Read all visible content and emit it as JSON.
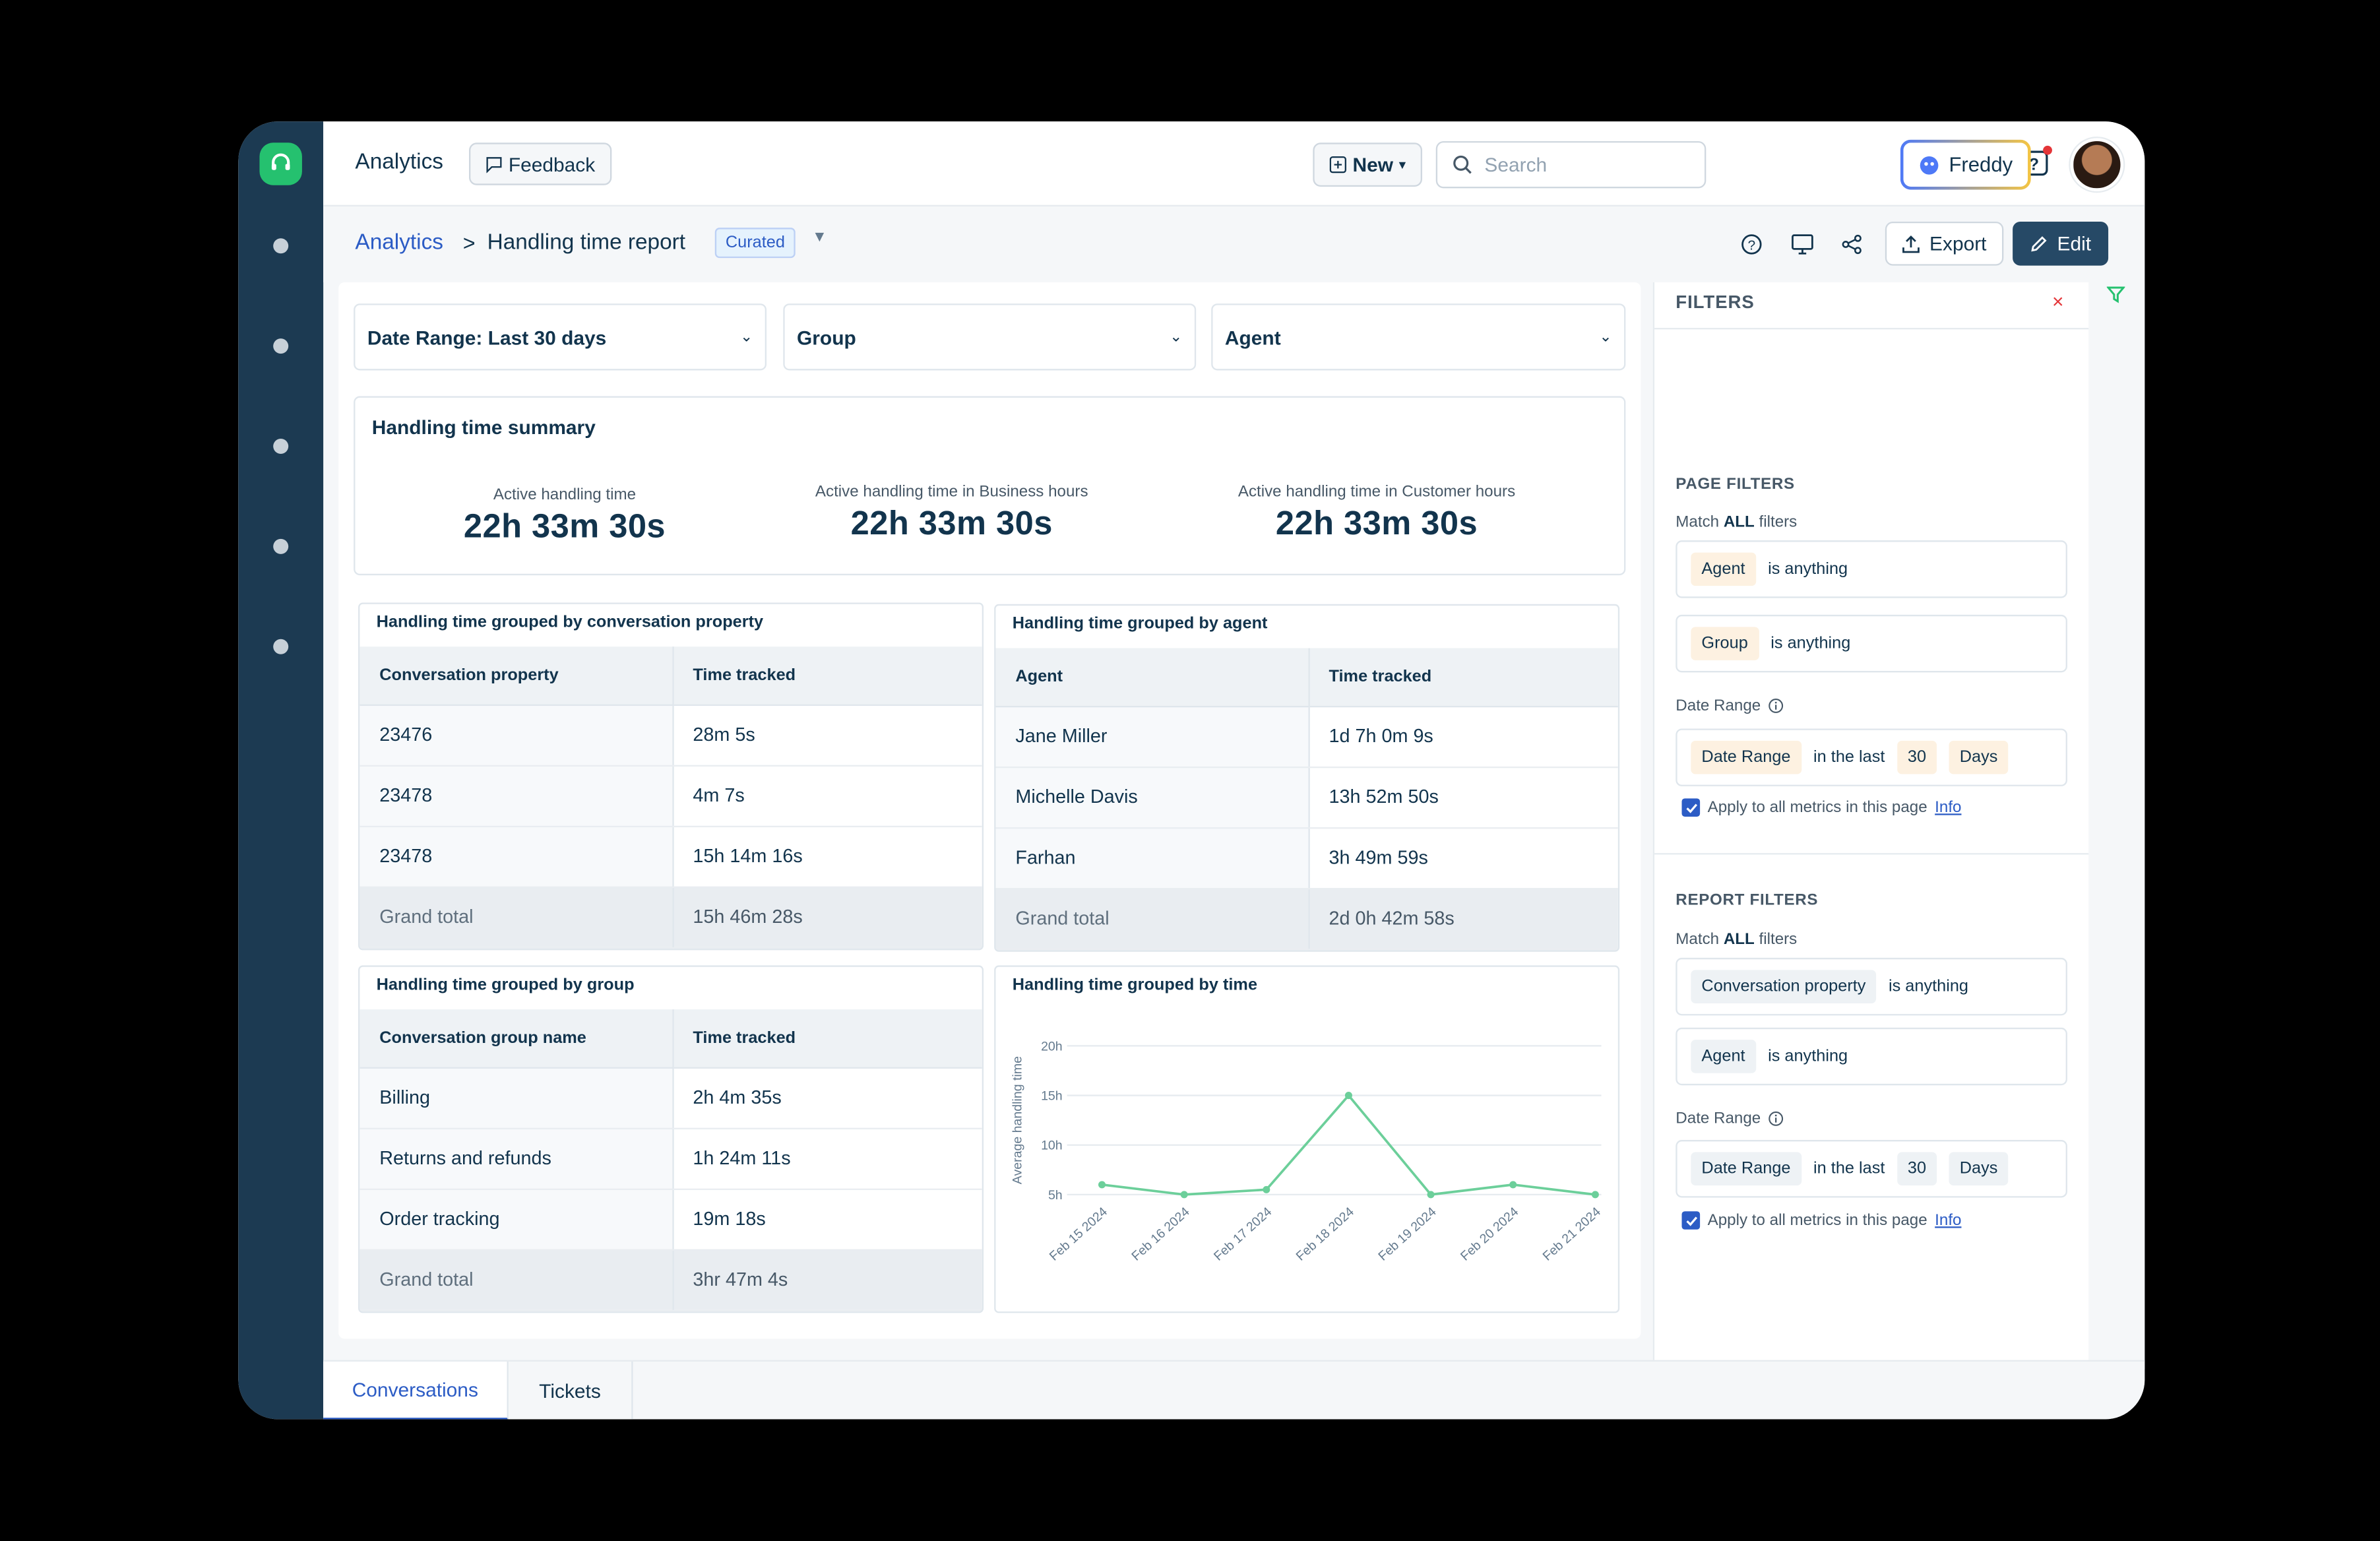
{
  "topbar": {
    "app_title": "Analytics",
    "feedback_label": "Feedback",
    "new_label": "New",
    "search_placeholder": "Search",
    "freddy_label": "Freddy"
  },
  "breadcrumb": {
    "root": "Analytics",
    "separator": ">",
    "current": "Handling time report",
    "badge": "Curated"
  },
  "actions": {
    "export_label": "Export",
    "edit_label": "Edit"
  },
  "dropdowns": {
    "date_range": "Date Range: Last 30 days",
    "group": "Group",
    "agent": "Agent"
  },
  "summary": {
    "title": "Handling time summary",
    "metrics": [
      {
        "label": "Active handling time",
        "value": "22h 33m 30s"
      },
      {
        "label": "Active handling time in Business hours",
        "value": "22h 33m 30s"
      },
      {
        "label": "Active handling time in Customer hours",
        "value": "22h 33m 30s"
      }
    ]
  },
  "by_property": {
    "title": "Handling time grouped by conversation property",
    "columns": [
      "Conversation property",
      "Time tracked"
    ],
    "rows": [
      [
        "23476",
        "28m 5s"
      ],
      [
        "23478",
        "4m 7s"
      ],
      [
        "23478",
        "15h 14m 16s"
      ]
    ],
    "total": [
      "Grand total",
      "15h 46m 28s"
    ]
  },
  "by_agent": {
    "title": "Handling time grouped by agent",
    "columns": [
      "Agent",
      "Time tracked"
    ],
    "rows": [
      [
        "Jane Miller",
        "1d 7h 0m 9s"
      ],
      [
        "Michelle Davis",
        "13h 52m 50s"
      ],
      [
        "Farhan",
        "3h 49m 59s"
      ]
    ],
    "total": [
      "Grand total",
      "2d 0h 42m 58s"
    ]
  },
  "by_group": {
    "title": "Handling time grouped by group",
    "columns": [
      "Conversation group name",
      "Time tracked"
    ],
    "rows": [
      [
        "Billing",
        "2h 4m 35s"
      ],
      [
        "Returns and refunds",
        "1h 24m 11s"
      ],
      [
        "Order tracking",
        "19m 18s"
      ]
    ],
    "total": [
      "Grand total",
      "3hr 47m 4s"
    ]
  },
  "by_time": {
    "title": "Handling time grouped by time"
  },
  "chart_data": {
    "type": "line",
    "title": "Handling time grouped by time",
    "ylabel": "Average handling time",
    "xlabel": "",
    "x": [
      "Feb 15 2024",
      "Feb 16 2024",
      "Feb 17 2024",
      "Feb 18 2024",
      "Feb 19 2024",
      "Feb 20 2024",
      "Feb 21 2024"
    ],
    "y_ticks": [
      "5h",
      "10h",
      "15h",
      "20h"
    ],
    "ylim": [
      5,
      20
    ],
    "series": [
      {
        "values": [
          6,
          5,
          5.5,
          15,
          5,
          6,
          5
        ],
        "color": "#6ccf9a"
      }
    ],
    "grid": true
  },
  "filters": {
    "title": "FILTERS",
    "close_icon": "×",
    "page": {
      "heading": "PAGE FILTERS",
      "match_prefix": "Match",
      "match_bold": "ALL",
      "match_suffix": "filters",
      "rules": [
        {
          "field": "Agent",
          "op": "is anything"
        },
        {
          "field": "Group",
          "op": "is anything"
        }
      ],
      "date_label": "Date Range",
      "date_field": "Date Range",
      "date_op": "in the last",
      "date_value": "30",
      "date_unit": "Days",
      "apply_label": "Apply to all metrics in this page",
      "info_label": "Info"
    },
    "report": {
      "heading": "REPORT FILTERS",
      "match_prefix": "Match",
      "match_bold": "ALL",
      "match_suffix": "filters",
      "rules": [
        {
          "field": "Conversation property",
          "op": "is anything"
        },
        {
          "field": "Agent",
          "op": "is anything"
        }
      ],
      "date_label": "Date Range",
      "date_field": "Date Range",
      "date_op": "in the last",
      "date_value": "30",
      "date_unit": "Days",
      "apply_label": "Apply to all metrics in this page",
      "info_label": "Info"
    }
  },
  "bottom_tabs": [
    "Conversations",
    "Tickets"
  ],
  "colors": {
    "accent": "#2c5cc5",
    "brand_green": "#25c16f",
    "sidebar": "#1c3a52",
    "line": "#6ccf9a"
  }
}
